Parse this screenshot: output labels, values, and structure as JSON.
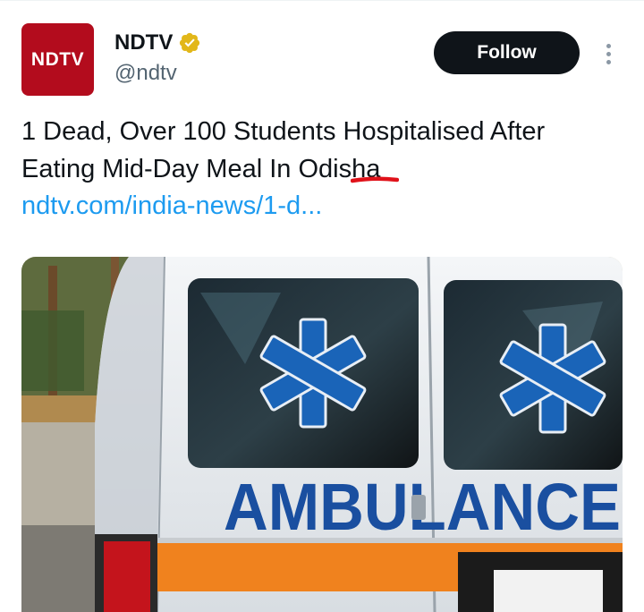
{
  "tweet": {
    "display_name": "NDTV",
    "handle": "@ndtv",
    "avatar_text": "NDTV",
    "verified_icon": "verified-gold-badge-icon",
    "follow_label": "Follow",
    "more_icon": "more-vertical-icon",
    "text_line1": "1 Dead, Over 100 Students Hospitalised After",
    "text_line2": "Eating Mid-Day Meal In Odisha",
    "link": "ndtv.com/india-news/1-d...",
    "media_text": "AMBULANCE"
  },
  "colors": {
    "brand_red": "#b30c1d",
    "link_blue": "#1d9bf0",
    "follow_bg": "#0f1419",
    "verified_gold": "#e2b719",
    "annotation_red": "#e0121a"
  }
}
